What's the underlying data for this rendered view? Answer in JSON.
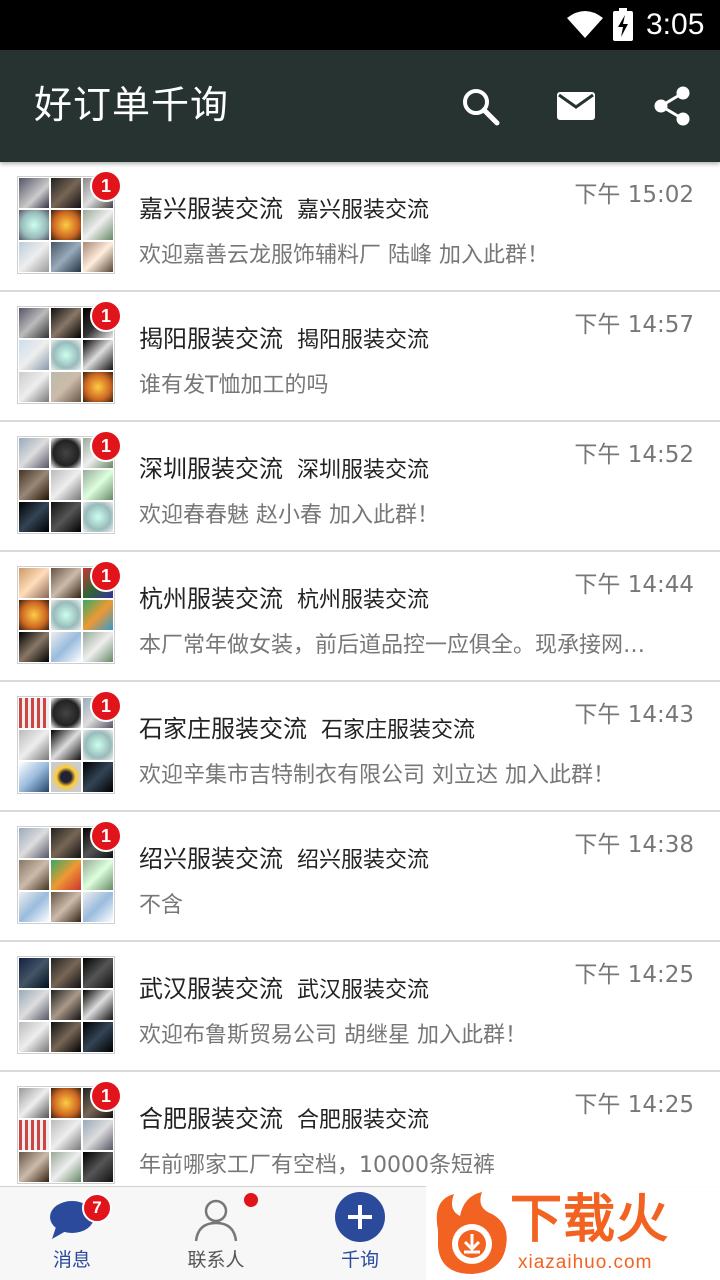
{
  "status_bar": {
    "time": "3:05"
  },
  "app_bar": {
    "title": "好订单千询"
  },
  "conversations": [
    {
      "name": "嘉兴服装交流",
      "sub": "嘉兴服装交流",
      "time": "下午 15:02",
      "message": "欢迎嘉善云龙服饰辅料厂 陆峰 加入此群！",
      "badge": "1"
    },
    {
      "name": "揭阳服装交流",
      "sub": "揭阳服装交流",
      "time": "下午 14:57",
      "message": "谁有发T恤加工的吗",
      "badge": "1"
    },
    {
      "name": "深圳服装交流",
      "sub": "深圳服装交流",
      "time": "下午 14:52",
      "message": "欢迎春春魅 赵小春 加入此群！",
      "badge": "1"
    },
    {
      "name": "杭州服装交流",
      "sub": "杭州服装交流",
      "time": "下午 14:44",
      "message": "本厂常年做女装，前后道品控一应俱全。现承接网…",
      "badge": "1"
    },
    {
      "name": "石家庄服装交流",
      "sub": "石家庄服装交流",
      "time": "下午 14:43",
      "message": "欢迎辛集市吉特制衣有限公司 刘立达 加入此群！",
      "badge": "1"
    },
    {
      "name": "绍兴服装交流",
      "sub": "绍兴服装交流",
      "time": "下午 14:38",
      "message": "不含",
      "badge": "1"
    },
    {
      "name": "武汉服装交流",
      "sub": "武汉服装交流",
      "time": "下午 14:25",
      "message": "欢迎布鲁斯贸易公司 胡继星 加入此群！",
      "badge": ""
    },
    {
      "name": "合肥服装交流",
      "sub": "合肥服装交流",
      "time": "下午 14:25",
      "message": "年前哪家工厂有空档，10000条短裤",
      "badge": "1"
    }
  ],
  "bottom_nav": {
    "messages": {
      "label": "消息",
      "badge": "7"
    },
    "contacts": {
      "label": "联系人"
    },
    "inquiry": {
      "label": "千询"
    }
  },
  "watermark": {
    "text": "下载火",
    "sub": "xiazaihuo.com"
  },
  "colors": {
    "app_bar": "#273330",
    "badge": "#e1141b",
    "nav_active": "#2b4a9b",
    "watermark": "#f26322"
  }
}
